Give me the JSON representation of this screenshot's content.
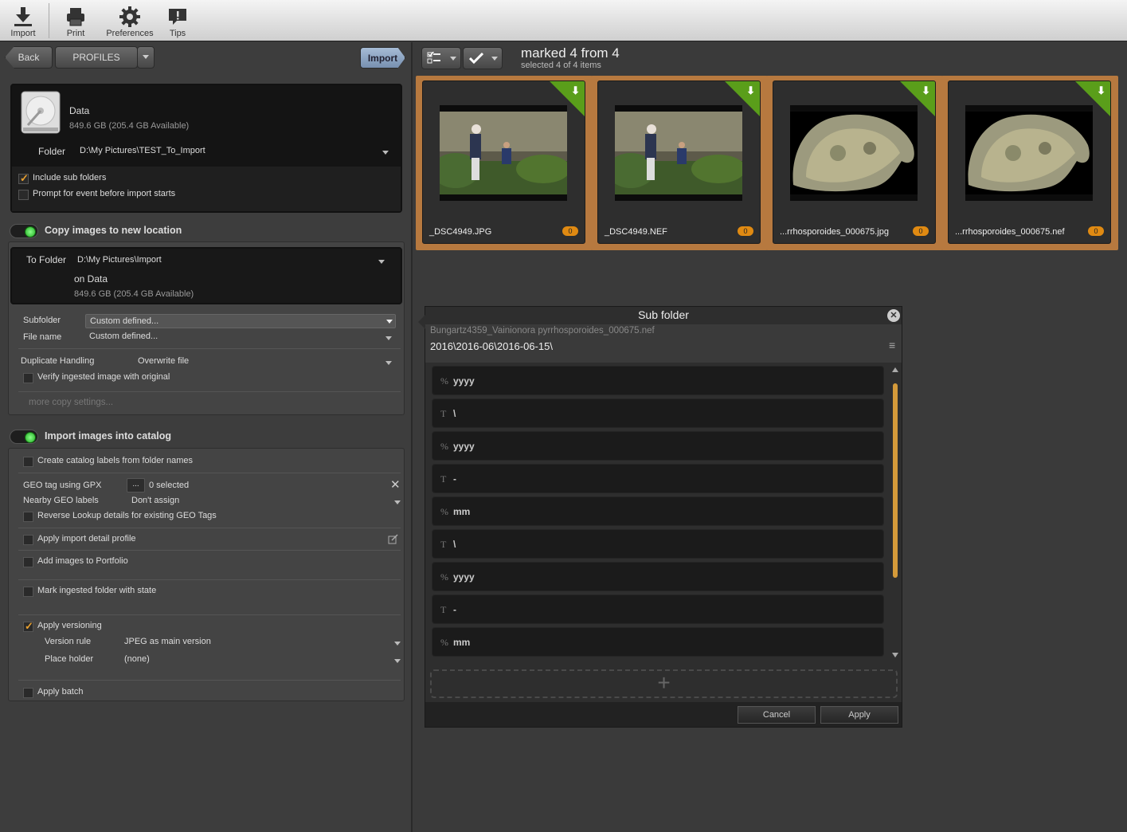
{
  "toolbar": {
    "import": "Import",
    "print": "Print",
    "preferences": "Preferences",
    "tips": "Tips"
  },
  "nav": {
    "back": "Back",
    "profiles": "PROFILES",
    "import_button": "Import"
  },
  "source": {
    "drive_name": "Data",
    "drive_space": "849.6 GB (205.4 GB Available)",
    "folder_label": "Folder",
    "folder_path": "D:\\My Pictures\\TEST_To_Import",
    "include_sub": "Include sub folders",
    "include_sub_checked": true,
    "prompt_event": "Prompt for event before import starts",
    "prompt_event_checked": false
  },
  "copy": {
    "title": "Copy images to new location",
    "to_folder_label": "To Folder",
    "to_folder_path": "D:\\My Pictures\\Import",
    "on_drive": "on Data",
    "space": "849.6 GB (205.4 GB Available)",
    "subfolder_label": "Subfolder",
    "subfolder_value": "Custom defined...",
    "filename_label": "File name",
    "filename_value": "Custom defined...",
    "dup_label": "Duplicate Handling",
    "dup_value": "Overwrite file",
    "verify": "Verify ingested image with original",
    "more": "more copy settings..."
  },
  "catalog": {
    "title": "Import images into catalog",
    "labels_from_folder": "Create catalog labels from folder names",
    "geo_tag": "GEO tag using GPX",
    "geo_btn": "...",
    "geo_selected": "0 selected",
    "nearby_label": "Nearby GEO labels",
    "nearby_value": "Don't assign",
    "reverse_lookup": "Reverse Lookup details for existing GEO Tags",
    "detail_profile": "Apply import detail profile",
    "portfolio": "Add images to Portfolio",
    "mark_folder": "Mark ingested folder with state",
    "versioning": "Apply versioning",
    "versioning_checked": true,
    "version_rule_label": "Version rule",
    "version_rule_value": "JPEG as main version",
    "placeholder_label": "Place holder",
    "placeholder_value": "(none)",
    "batch": "Apply batch"
  },
  "header": {
    "marked": "marked 4 from 4",
    "selected": "selected 4 of 4 items"
  },
  "thumbnails": [
    {
      "name": "_DSC4949.JPG",
      "badge": "0",
      "kind": "garden"
    },
    {
      "name": "_DSC4949.NEF",
      "badge": "0",
      "kind": "garden"
    },
    {
      "name": "...rrhosporoides_000675.jpg",
      "badge": "0",
      "kind": "lichen"
    },
    {
      "name": "...rrhosporoides_000675.nef",
      "badge": "0",
      "kind": "lichen"
    }
  ],
  "dialog": {
    "title": "Sub folder",
    "filename_preview": "Bungartz4359_Vainionora pyrrhosporoides_000675.nef",
    "path_preview": "2016\\2016-06\\2016-06-15\\",
    "tokens": [
      {
        "type": "%",
        "text": "yyyy"
      },
      {
        "type": "T",
        "text": "\\"
      },
      {
        "type": "%",
        "text": "yyyy"
      },
      {
        "type": "T",
        "text": "-"
      },
      {
        "type": "%",
        "text": "mm"
      },
      {
        "type": "T",
        "text": "\\"
      },
      {
        "type": "%",
        "text": "yyyy"
      },
      {
        "type": "T",
        "text": "-"
      },
      {
        "type": "%",
        "text": "mm"
      }
    ],
    "add": "+",
    "cancel": "Cancel",
    "apply": "Apply"
  },
  "colors": {
    "accent_orange": "#b7793f",
    "badge": "#e08a12",
    "corner_green": "#5a9e1a",
    "toggle_green": "#2a2"
  }
}
